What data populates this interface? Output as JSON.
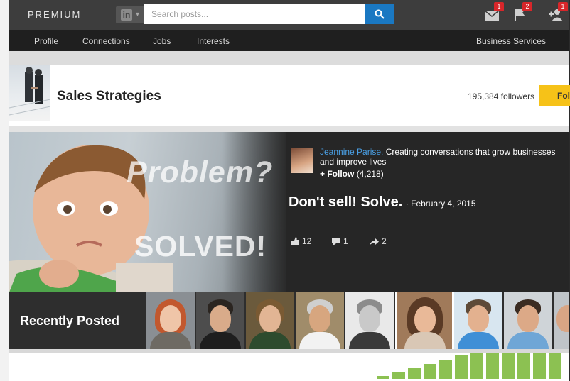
{
  "topbar": {
    "brand": "PREMIUM",
    "search_placeholder": "Search posts...",
    "badges": {
      "messages": "1",
      "notifications": "2",
      "invitations": "1"
    }
  },
  "subnav": {
    "items": [
      "Profile",
      "Connections",
      "Jobs",
      "Interests"
    ],
    "right_item": "Business Services"
  },
  "channel": {
    "title": "Sales Strategies",
    "followers": "195,384 followers",
    "follow_label": "Follow"
  },
  "hero": {
    "meme_top": "Problem?",
    "meme_bottom": "SOLVED!",
    "author_name": "Jeannine Parise,",
    "author_tagline": "Creating conversations that grow businesses and improve lives",
    "follow_label": "+ Follow",
    "follow_count": "(4,218)",
    "post_title": "Don't sell! Solve.",
    "post_date": "· February 4, 2015",
    "likes": "12",
    "comments": "1",
    "shares": "2"
  },
  "recent": {
    "label": "Recently Posted"
  },
  "colors": {
    "topbar": "#3d3d3d",
    "subnav": "#1f1f1f",
    "search_button": "#1a78c2",
    "follow_button": "#f6c218",
    "author_link": "#4aa0e6",
    "badge": "#d8262a",
    "bars": "#8cc152"
  }
}
